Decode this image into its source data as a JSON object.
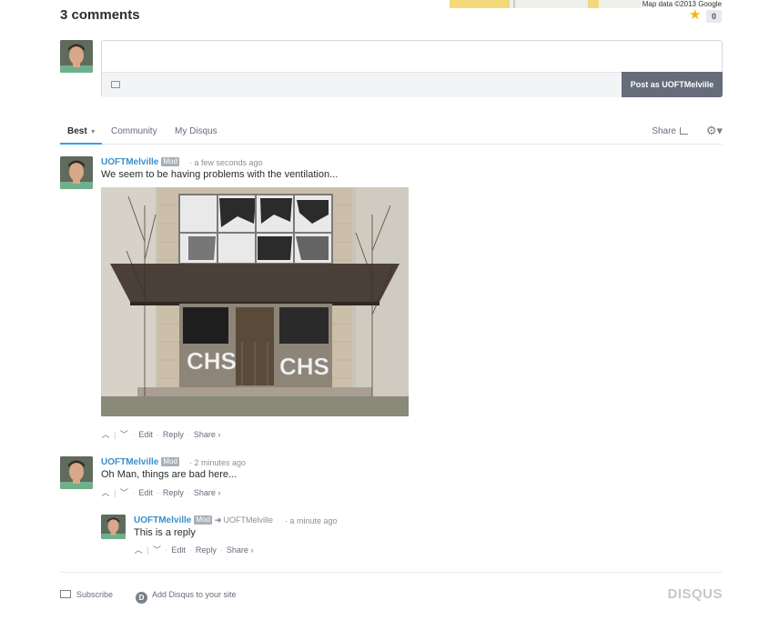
{
  "map": {
    "credit": "Map data ©2013 Google"
  },
  "star": {
    "count": "0",
    "icon": "star-icon",
    "color": "#f7b500"
  },
  "header": {
    "comment_count": "3 comments"
  },
  "composer": {
    "placeholder": "",
    "post_label": "Post as UOFTMelville",
    "image_icon": "image-icon"
  },
  "nav": {
    "tabs": [
      {
        "label": "Best",
        "active": true
      },
      {
        "label": "Community",
        "active": false
      },
      {
        "label": "My Disqus",
        "active": false
      }
    ],
    "share_label": "Share",
    "settings_icon": "gear-icon"
  },
  "comments": [
    {
      "author": "UOFTMelville",
      "badge": "Mod",
      "time": "a few seconds ago",
      "text": "We seem to be having problems with the ventilation...",
      "has_image": true,
      "actions": {
        "edit": "Edit",
        "reply": "Reply",
        "share": "Share ›"
      }
    },
    {
      "author": "UOFTMelville",
      "badge": "Mod",
      "time": "2 minutes ago",
      "text": "Oh Man, things are bad here...",
      "actions": {
        "edit": "Edit",
        "reply": "Reply",
        "share": "Share ›"
      },
      "replies": [
        {
          "author": "UOFTMelville",
          "badge": "Mod",
          "reply_to": "UOFTMelville",
          "time": "a minute ago",
          "text": "This is a reply",
          "actions": {
            "edit": "Edit",
            "reply": "Reply",
            "share": "Share ›"
          }
        }
      ]
    }
  ],
  "footer": {
    "subscribe": "Subscribe",
    "add_disqus": "Add Disqus to your site",
    "logo": "DISQUS"
  },
  "colors": {
    "accent": "#2e9fff",
    "author": "#3b8fc9",
    "post_button": "#656c7a"
  }
}
